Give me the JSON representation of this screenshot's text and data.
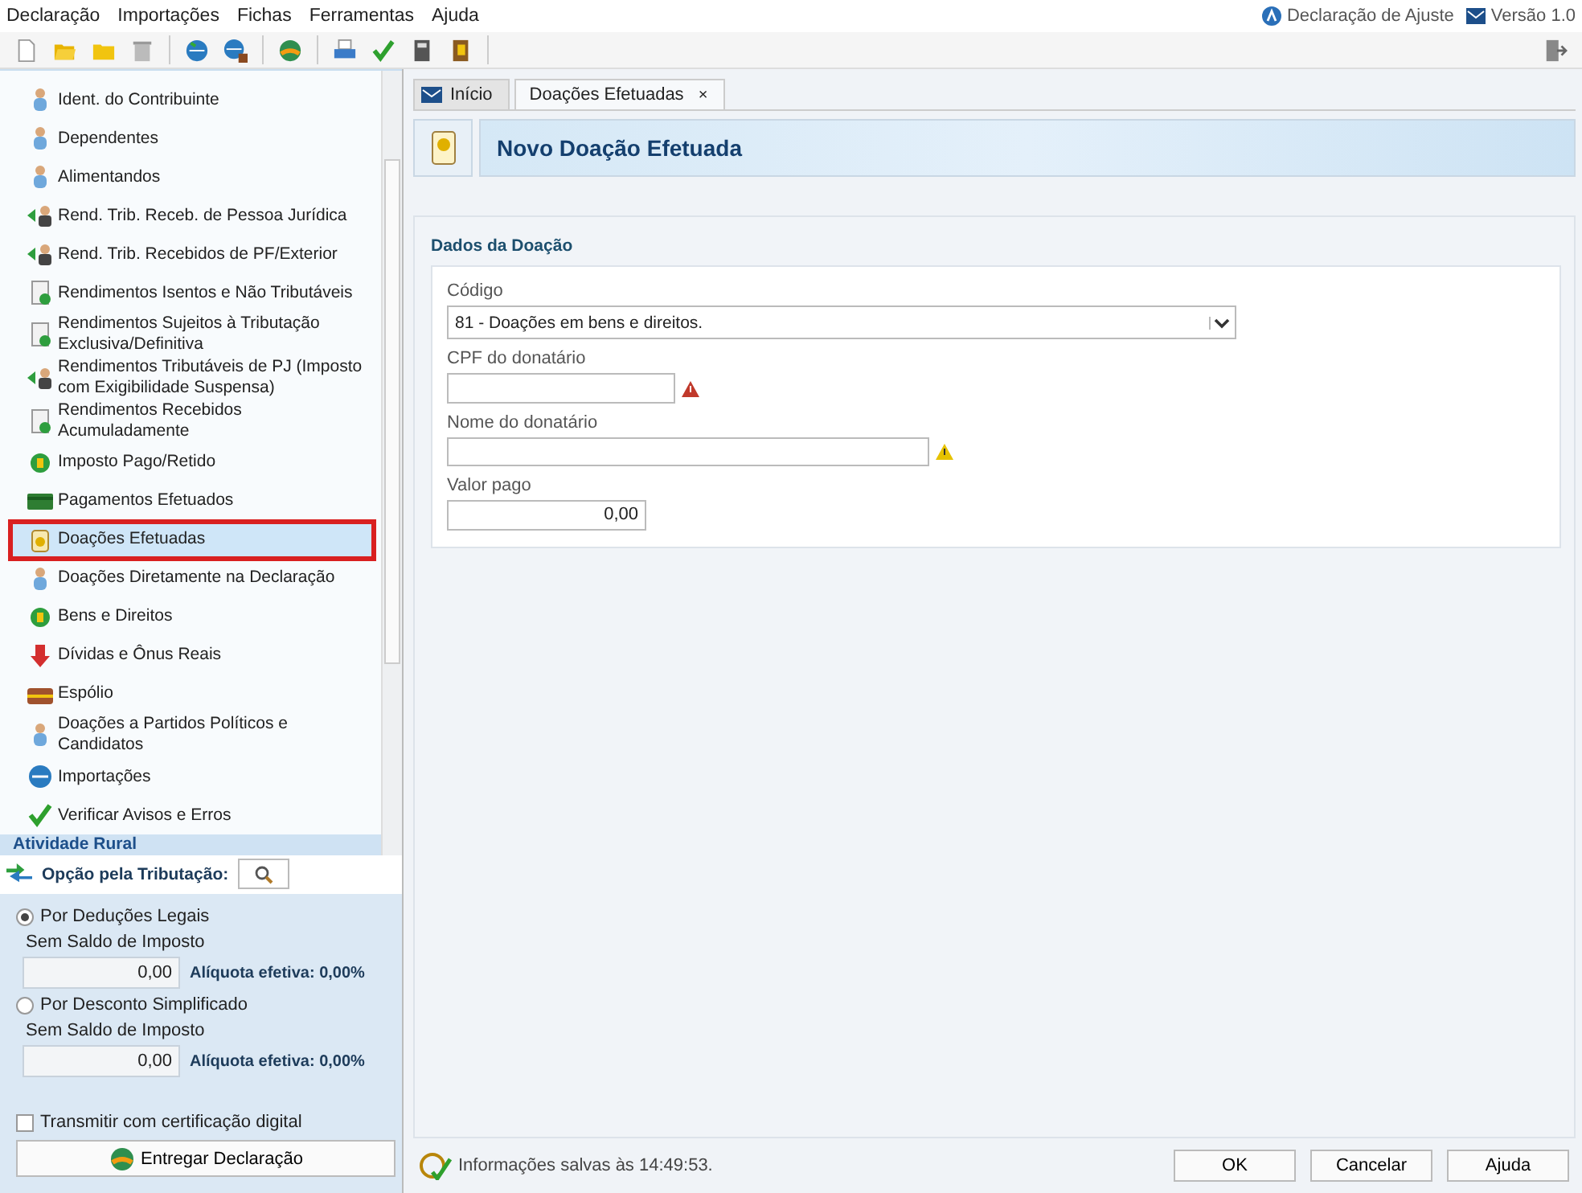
{
  "menu": [
    "Declaração",
    "Importações",
    "Fichas",
    "Ferramentas",
    "Ajuda"
  ],
  "header_right": {
    "declaration": "Declaração de Ajuste",
    "version": "Versão 1.0"
  },
  "sidebar": {
    "items": [
      {
        "label": "Ident. do Contribuinte",
        "selected": false
      },
      {
        "label": "Dependentes",
        "selected": false
      },
      {
        "label": "Alimentandos",
        "selected": false
      },
      {
        "label": "Rend. Trib. Receb. de Pessoa Jurídica",
        "selected": false
      },
      {
        "label": "Rend. Trib. Recebidos de PF/Exterior",
        "selected": false
      },
      {
        "label": "Rendimentos Isentos e Não Tributáveis",
        "selected": false
      },
      {
        "label": "Rendimentos Sujeitos à Tributação Exclusiva/Definitiva",
        "selected": false
      },
      {
        "label": "Rendimentos Tributáveis de PJ (Imposto com Exigibilidade Suspensa)",
        "selected": false
      },
      {
        "label": "Rendimentos Recebidos Acumuladamente",
        "selected": false
      },
      {
        "label": "Imposto Pago/Retido",
        "selected": false
      },
      {
        "label": "Pagamentos Efetuados",
        "selected": false
      },
      {
        "label": "Doações Efetuadas",
        "selected": true
      },
      {
        "label": "Doações Diretamente na Declaração",
        "selected": false
      },
      {
        "label": "Bens e Direitos",
        "selected": false
      },
      {
        "label": "Dívidas e Ônus Reais",
        "selected": false
      },
      {
        "label": "Espólio",
        "selected": false
      },
      {
        "label": "Doações a Partidos Políticos e Candidatos",
        "selected": false
      },
      {
        "label": "Importações",
        "selected": false
      },
      {
        "label": "Verificar Avisos e Erros",
        "selected": false
      }
    ],
    "section": "Atividade Rural"
  },
  "taxation": {
    "title": "Opção pela Tributação:",
    "options": [
      {
        "label": "Por Deduções Legais",
        "selected": true,
        "sublabel": "Sem Saldo de Imposto",
        "value": "0,00",
        "rate": "Alíquota efetiva: 0,00%"
      },
      {
        "label": "Por Desconto Simplificado",
        "selected": false,
        "sublabel": "Sem Saldo de Imposto",
        "value": "0,00",
        "rate": "Alíquota efetiva: 0,00%"
      }
    ],
    "certificate": {
      "label": "Transmitir com certificação digital",
      "checked": false
    },
    "submit": "Entregar Declaração"
  },
  "tabs": [
    {
      "label": "Início",
      "selected": false
    },
    {
      "label": "Doações Efetuadas",
      "selected": true,
      "close": "×"
    }
  ],
  "page_title": "Novo Doação Efetuada",
  "form": {
    "section": "Dados da Doação",
    "code": {
      "label": "Código",
      "value": "81 - Doações em bens e direitos."
    },
    "cpf": {
      "label": "CPF do donatário"
    },
    "name": {
      "label": "Nome do donatário"
    },
    "amount": {
      "label": "Valor pago",
      "value": "0,00"
    }
  },
  "status": "Informações salvas às 14:49:53.",
  "buttons": [
    "OK",
    "Cancelar",
    "Ajuda"
  ]
}
